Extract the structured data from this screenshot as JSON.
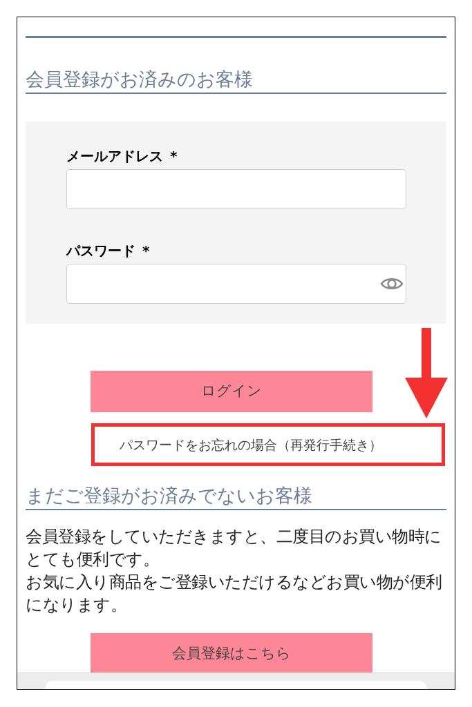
{
  "login_section": {
    "heading": "会員登録がお済みのお客様",
    "fields": [
      {
        "label": "メールアドレス",
        "required_mark": "*",
        "kind": "text"
      },
      {
        "label": "パスワード",
        "required_mark": "*",
        "kind": "password"
      }
    ],
    "login_button": "ログイン",
    "forgot_link": {
      "text": "パスワードをお忘れの場合（再発行手続き）",
      "highlighted": true
    }
  },
  "register_section": {
    "heading": "まだご登録がお済みでないお客様",
    "paragraphs": [
      "会員登録をしていただきますと、二度目のお買い物時にとても便利です。",
      "お気に入り商品をご登録いただけるなどお買い物が便利になります。"
    ],
    "register_button": "会員登録はこちら"
  }
}
